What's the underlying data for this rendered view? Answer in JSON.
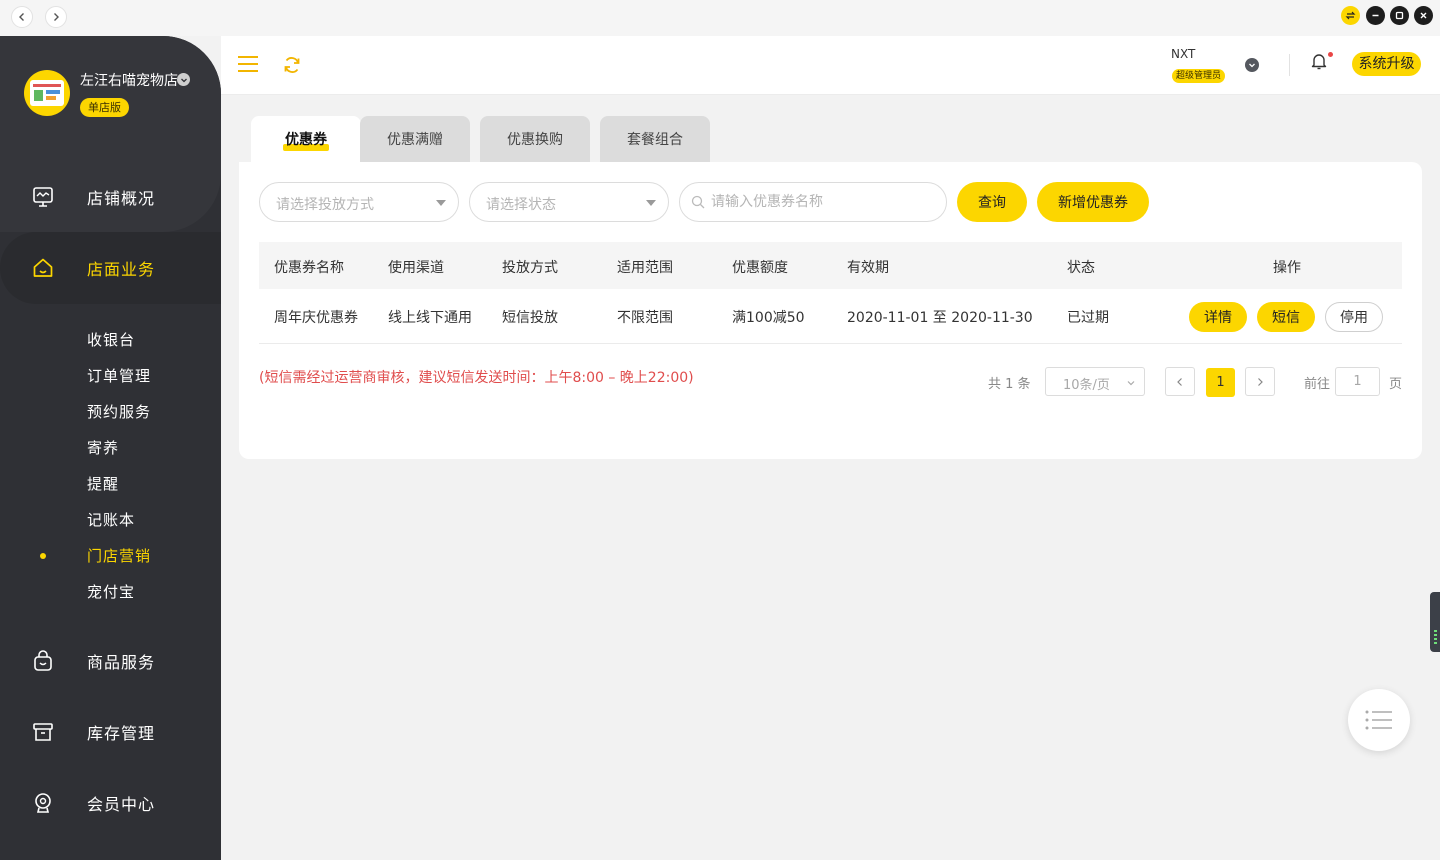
{
  "window": {
    "back_icon": "chevron-left-icon",
    "forward_icon": "chevron-right-icon",
    "controls": [
      "swap-icon",
      "minimize-icon",
      "maximize-icon",
      "close-icon"
    ]
  },
  "store": {
    "name": "左汪右喵宠物店",
    "badge": "单店版"
  },
  "sidebar": {
    "menu": [
      {
        "label": "店铺概况",
        "icon": "monitor-icon"
      },
      {
        "label": "店面业务",
        "icon": "home-icon",
        "active": true
      },
      {
        "label": "商品服务",
        "icon": "bag-icon"
      },
      {
        "label": "库存管理",
        "icon": "box-icon"
      },
      {
        "label": "会员中心",
        "icon": "member-icon"
      }
    ],
    "submenu": [
      {
        "label": "收银台"
      },
      {
        "label": "订单管理"
      },
      {
        "label": "预约服务"
      },
      {
        "label": "寄养"
      },
      {
        "label": "提醒"
      },
      {
        "label": "记账本"
      },
      {
        "label": "门店营销",
        "active": true
      },
      {
        "label": "宠付宝"
      }
    ]
  },
  "topbar": {
    "user_name": "NXT",
    "user_role": "超级管理员",
    "upgrade_label": "系统升级"
  },
  "tabs": [
    {
      "label": "优惠券",
      "active": true
    },
    {
      "label": "优惠满赠"
    },
    {
      "label": "优惠换购"
    },
    {
      "label": "套餐组合"
    }
  ],
  "filters": {
    "method_placeholder": "请选择投放方式",
    "status_placeholder": "请选择状态",
    "search_placeholder": "请输入优惠券名称",
    "query_label": "查询",
    "add_label": "新增优惠券"
  },
  "table": {
    "columns": [
      "优惠券名称",
      "使用渠道",
      "投放方式",
      "适用范围",
      "优惠额度",
      "有效期",
      "状态",
      "操作"
    ],
    "rows": [
      {
        "name": "周年庆优惠券",
        "channel": "线上线下通用",
        "method": "短信投放",
        "scope": "不限范围",
        "amount": "满100减50",
        "period": "2020-11-01 至 2020-11-30",
        "status": "已过期",
        "actions": [
          "详情",
          "短信",
          "停用"
        ]
      }
    ]
  },
  "notice": "(短信需经过运营商审核，建议短信发送时间：上午8:00 – 晚上22:00)",
  "pagination": {
    "total_text": "共 1 条",
    "page_size": "10条/页",
    "current_page": "1",
    "goto_label": "前往",
    "goto_value": "1",
    "page_suffix": "页"
  },
  "colors": {
    "accent": "#fcd600",
    "sidebar_bg": "#2f3035",
    "notice_red": "#e04d4d"
  }
}
